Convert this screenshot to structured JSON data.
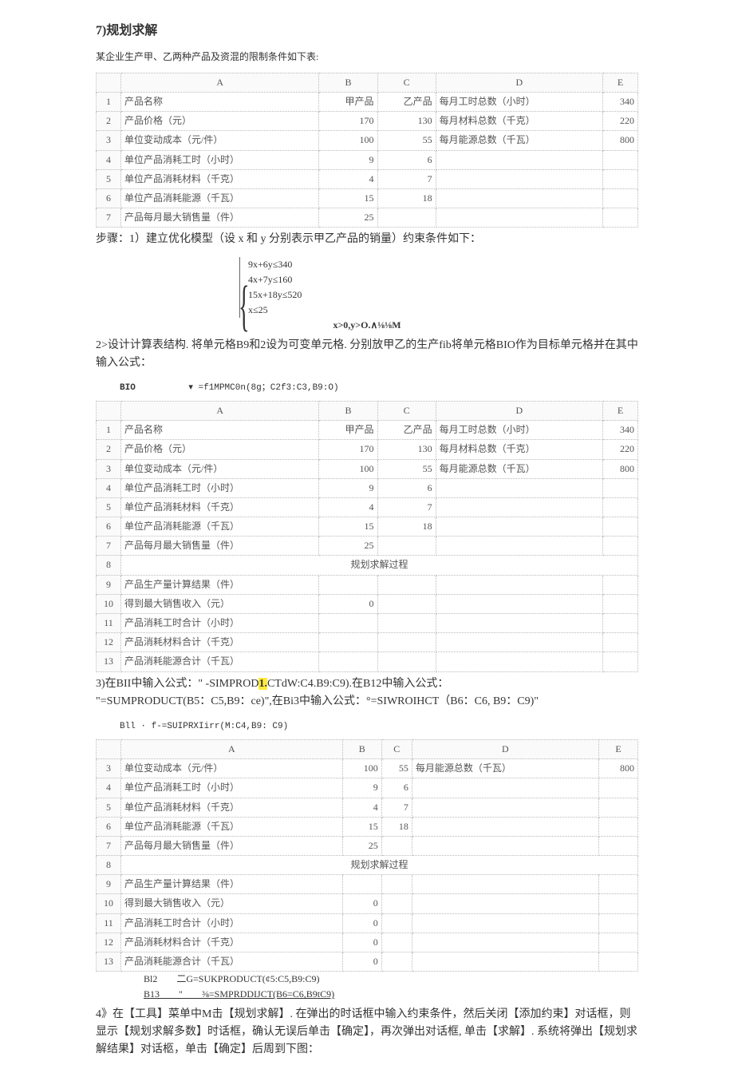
{
  "title": "7)规划求解",
  "intro": "某企业生产甲、乙两种产品及资混的限制条件如下表:",
  "columns": [
    "",
    "A",
    "B",
    "C",
    "D",
    "E"
  ],
  "table1": {
    "rows": [
      {
        "n": "1",
        "a": "产品名称",
        "b": "甲产品",
        "c": "乙产品",
        "d": "每月工时总数（小时）",
        "e": "340"
      },
      {
        "n": "2",
        "a": "产品价格（元）",
        "b": "170",
        "c": "130",
        "d": "每月材料总数（千克）",
        "e": "220"
      },
      {
        "n": "3",
        "a": "单位变动成本（元/件）",
        "b": "100",
        "c": "55",
        "d": "每月能源总数（千瓦）",
        "e": "800"
      },
      {
        "n": "4",
        "a": "单位产品消耗工时（小时）",
        "b": "9",
        "c": "6",
        "d": "",
        "e": ""
      },
      {
        "n": "5",
        "a": "单位产品消耗材料（千克）",
        "b": "4",
        "c": "7",
        "d": "",
        "e": ""
      },
      {
        "n": "6",
        "a": "单位产品消耗能源（千瓦）",
        "b": "15",
        "c": "18",
        "d": "",
        "e": ""
      },
      {
        "n": "7",
        "a": "产品每月最大销售量（件）",
        "b": "25",
        "c": "",
        "d": "",
        "e": ""
      }
    ]
  },
  "step1": "步骤：1）建立优化模型（设 x 和 y 分别表示甲乙产品的销量）约束条件如下：",
  "constraints": [
    "9x+6y≤340",
    "4x+7y≤160",
    "15x+18y≤520",
    "x≤25"
  ],
  "constraint_extra": "x>0,y>O.∧⅛⅛M",
  "step2": "2>设计计算表结构. 将单元格B9和2设为可变单元格. 分别放甲乙的生产fib将单元格BIO作为目标单元格并在其中输入公式：",
  "formula_bar1_cell": "BIO",
  "formula_bar1_val": "▾ =f1MPMC0n(8g；C2f3:C3,B9:O)",
  "table2": {
    "rows": [
      {
        "n": "1",
        "a": "产品名称",
        "b": "甲产品",
        "c": "乙产品",
        "d": "每月工时总数（小时）",
        "e": "340"
      },
      {
        "n": "2",
        "a": "产品价格（元）",
        "b": "170",
        "c": "130",
        "d": "每月材料总数（千克）",
        "e": "220"
      },
      {
        "n": "3",
        "a": "单位变动成本（元/件）",
        "b": "100",
        "c": "55",
        "d": "每月能源总数（千瓦）",
        "e": "800"
      },
      {
        "n": "4",
        "a": "单位产品消耗工时（小时）",
        "b": "9",
        "c": "6",
        "d": "",
        "e": ""
      },
      {
        "n": "5",
        "a": "单位产品消耗材料（千克）",
        "b": "4",
        "c": "7",
        "d": "",
        "e": ""
      },
      {
        "n": "6",
        "a": "单位产品消耗能源（千瓦）",
        "b": "15",
        "c": "18",
        "d": "",
        "e": ""
      },
      {
        "n": "7",
        "a": "产品每月最大销售量（件）",
        "b": "25",
        "c": "",
        "d": "",
        "e": ""
      },
      {
        "n": "8",
        "a": "",
        "merge": "规划求解过程"
      },
      {
        "n": "9",
        "a": "产品生产量计算结果（件）",
        "b": "",
        "c": "",
        "d": "",
        "e": ""
      },
      {
        "n": "10",
        "a": "得到最大销售收入（元）",
        "b": "0",
        "c": "",
        "d": "",
        "e": ""
      },
      {
        "n": "11",
        "a": "产品消耗工时合计（小时）",
        "b": "",
        "c": "",
        "d": "",
        "e": ""
      },
      {
        "n": "12",
        "a": "产品消耗材料合计（千克）",
        "b": "",
        "c": "",
        "d": "",
        "e": ""
      },
      {
        "n": "13",
        "a": "产品消耗能源合计（千瓦）",
        "b": "",
        "c": "",
        "d": "",
        "e": ""
      }
    ]
  },
  "step3a": "3)在BII中输入公式：\" -SIMPROD",
  "step3a_hl": "1.",
  "step3b": "CTdW:C4.B9:C9).在B12中输入公式：",
  "step3c": "\"=SUMPRODUCT(B5：C5,B9：ce)\",在Bi3中输入公式：°=SIWROIHCT（B6：C6, B9：C9)\"",
  "formula_bar2": "Bll · f-=SUIPRXIirr(M:C4,B9: C9)",
  "table3": {
    "rows": [
      {
        "n": "3",
        "a": "单位变动成本（元/件）",
        "b": "100",
        "c": "55",
        "d": "每月能源总数（千瓦）",
        "e": "800"
      },
      {
        "n": "4",
        "a": "单位产品消耗工时（小时）",
        "b": "9",
        "c": "6",
        "d": "",
        "e": ""
      },
      {
        "n": "5",
        "a": "单位产品消耗材料（千克）",
        "b": "4",
        "c": "7",
        "d": "",
        "e": ""
      },
      {
        "n": "6",
        "a": "单位产品消耗能源（千瓦）",
        "b": "15",
        "c": "18",
        "d": "",
        "e": ""
      },
      {
        "n": "7",
        "a": "产品每月最大销售量（件）",
        "b": "25",
        "c": "",
        "d": "",
        "e": ""
      },
      {
        "n": "8",
        "a": "",
        "merge": "规划求解过程"
      },
      {
        "n": "9",
        "a": "产品生产量计算结果（件）",
        "b": "",
        "c": "",
        "d": "",
        "e": ""
      },
      {
        "n": "10",
        "a": "得到最大销售收入（元）",
        "b": "0",
        "c": "",
        "d": "",
        "e": ""
      },
      {
        "n": "11",
        "a": "产品消耗工时合计（小时）",
        "b": "0",
        "c": "",
        "d": "",
        "e": ""
      },
      {
        "n": "12",
        "a": "产品消耗材料合计（千克）",
        "b": "0",
        "c": "",
        "d": "",
        "e": ""
      },
      {
        "n": "13",
        "a": "产品消耗能源合计（千瓦）",
        "b": "0",
        "c": "",
        "d": "",
        "e": ""
      }
    ]
  },
  "extra_b12": "Bl2　　二G=SUKPRODUCT(¢5:C5,B9:C9)",
  "extra_b13": "B13　　\"　　⅜=SMPRDDIJCT(B6=C6,B9tC9)",
  "step4": "4》在【工具】菜单中M击【规划求解】. 在弹出的时话框中输入约束条件，然后关闭【添加约束】对话框，则显示【规划求解多数】时话框，确认无误后单击【确定】，再次弹出对话框, 单击【求解】. 系统将弹出【规划求解结果】对话柩，单击【确定】后周到下图："
}
